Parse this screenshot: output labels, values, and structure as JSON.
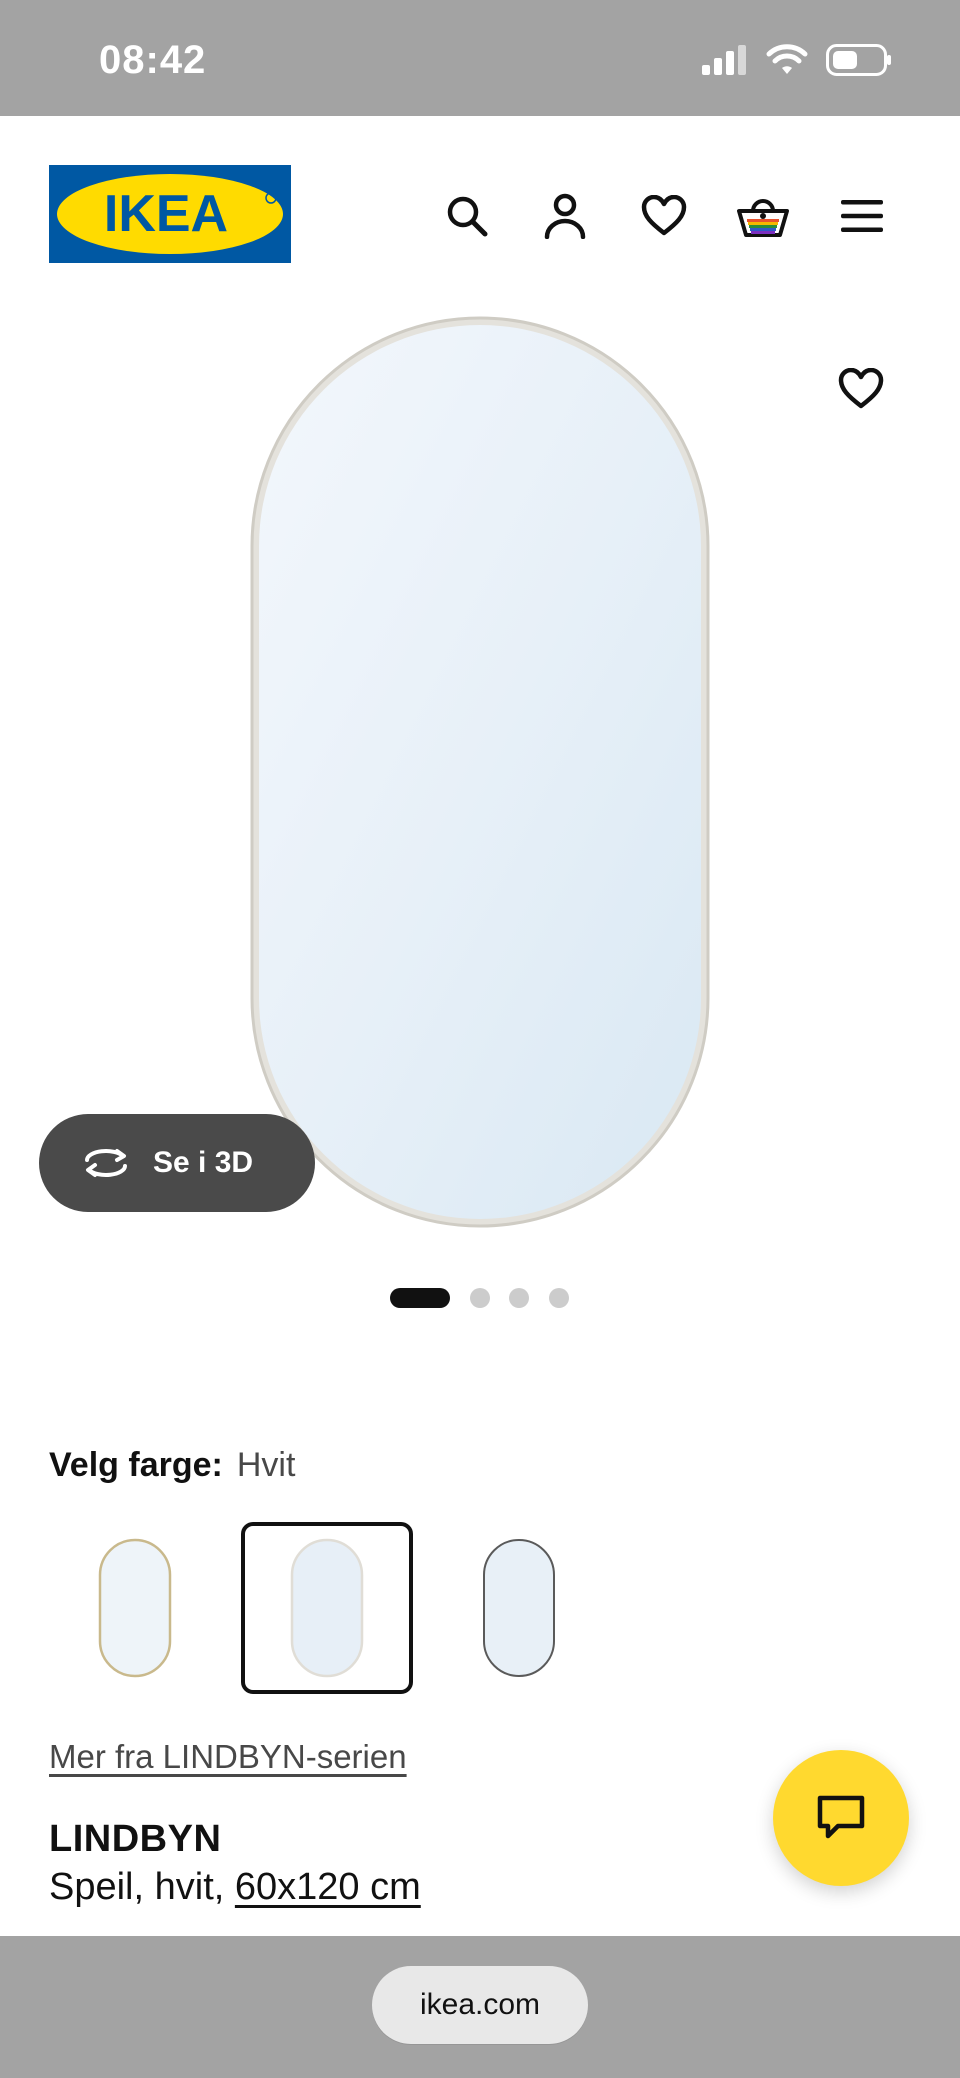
{
  "status_bar": {
    "time": "08:42",
    "icons": [
      "signal-icon",
      "wifi-icon",
      "battery-icon"
    ]
  },
  "header": {
    "logo_text": "IKEA",
    "brand_colors": {
      "blue": "#0058a3",
      "yellow": "#ffdb00"
    },
    "icons": [
      "search-icon",
      "account-icon",
      "heart-icon",
      "basket-icon",
      "menu-icon"
    ]
  },
  "hero": {
    "see_3d_label": "Se i 3D",
    "favorite_icon": "heart-icon",
    "carousel": {
      "total": 4,
      "active": 1
    }
  },
  "color_picker": {
    "label": "Velg farge:",
    "selected_value": "Hvit",
    "options_count": 3,
    "selected_index": 2
  },
  "series_link": "Mer fra LINDBYN-serien",
  "product": {
    "name": "LINDBYN",
    "description": "Speil, hvit, ",
    "size_link": "60x120 cm"
  },
  "chat_button_icon": "chat-icon",
  "browser": {
    "url": "ikea.com"
  }
}
